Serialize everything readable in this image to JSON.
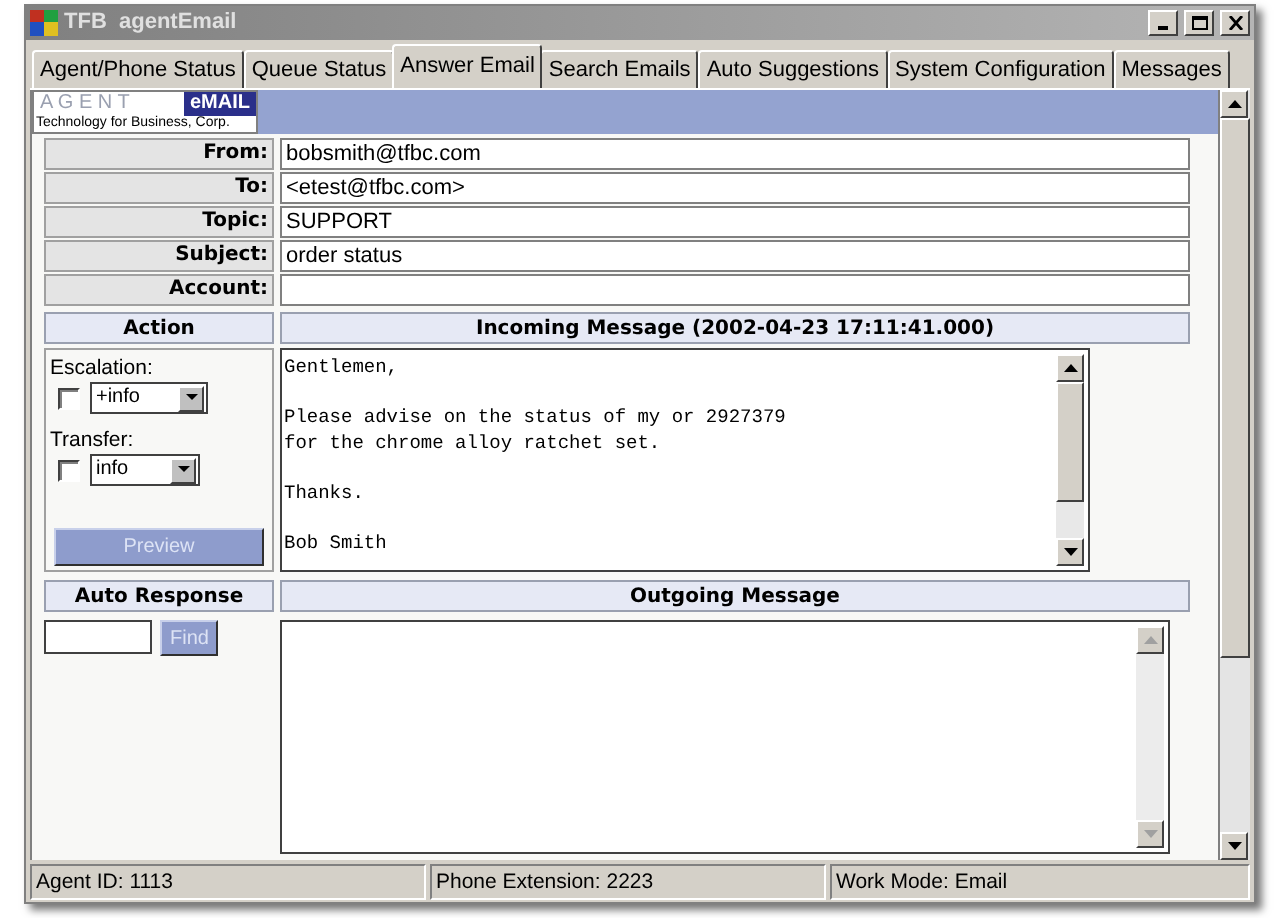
{
  "window": {
    "title": "TFB  agentEmail"
  },
  "tabs": [
    {
      "label": "Agent/Phone Status",
      "selected": false
    },
    {
      "label": "Queue Status",
      "selected": false
    },
    {
      "label": "Answer Email",
      "selected": true
    },
    {
      "label": "Search Emails",
      "selected": false
    },
    {
      "label": "Auto Suggestions",
      "selected": false
    },
    {
      "label": "System Configuration",
      "selected": false
    },
    {
      "label": "Messages",
      "selected": false
    }
  ],
  "logo": {
    "part_1": "A G E N T",
    "part_2": "eMAIL",
    "tagline": "Technology for Business, Corp."
  },
  "fields": [
    {
      "label": "From:",
      "value": "bobsmith@tfbc.com"
    },
    {
      "label": "To:",
      "value": "<etest@tfbc.com>"
    },
    {
      "label": "Topic:",
      "value": "SUPPORT"
    },
    {
      "label": "Subject:",
      "value": "order status"
    },
    {
      "label": "Account:"
    }
  ],
  "action": {
    "header": "Action",
    "escalation": {
      "label": "Escalation:",
      "checked": false,
      "value": "+info"
    },
    "transfer": {
      "label": "Transfer:",
      "checked": false,
      "value": "info"
    },
    "preview_button": "Preview"
  },
  "incoming": {
    "header": "Incoming Message (2002-04-23 17:11:41.000)",
    "body": "Gentlemen,\n\nPlease advise on the status of my or 2927379\nfor the chrome alloy ratchet set.\n\nThanks.\n\nBob Smith"
  },
  "auto_response": {
    "header": "Auto Response",
    "find_button": "Find"
  },
  "outgoing": {
    "header": "Outgoing Message"
  },
  "status_bar": [
    "Agent ID: 1113",
    "Phone Extension: 2223",
    "Work Mode: Email"
  ]
}
